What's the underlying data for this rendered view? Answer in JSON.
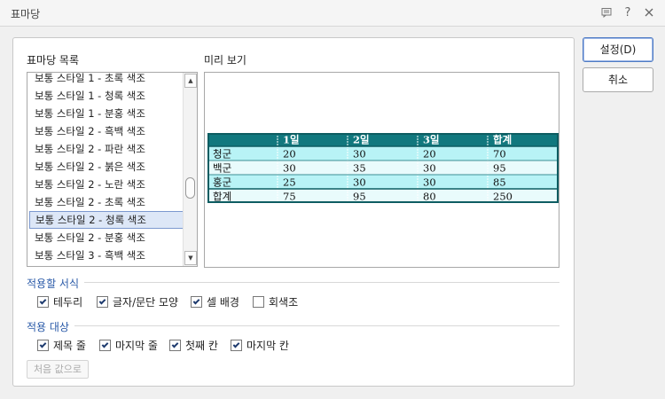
{
  "window": {
    "title": "표마당"
  },
  "titlebar_icons": [
    "comment-icon",
    "help-icon",
    "close-icon"
  ],
  "labels": {
    "list_title": "표마당 목록",
    "preview_title": "미리 보기"
  },
  "style_list": {
    "selected_index": 8,
    "items": [
      "보통 스타일 1 - 초록 색조",
      "보통 스타일 1 - 청록 색조",
      "보통 스타일 1 - 분홍 색조",
      "보통 스타일 2 - 흑백 색조",
      "보통 스타일 2 - 파란 색조",
      "보통 스타일 2 - 붉은 색조",
      "보통 스타일 2 - 노란 색조",
      "보통 스타일 2 - 초록 색조",
      "보통 스타일 2 - 청록 색조",
      "보통 스타일 2 - 분홍 색조",
      "보통 스타일 3 - 흑백 색조"
    ]
  },
  "preview_table": {
    "header": [
      "",
      "1일",
      "2일",
      "3일",
      "합계"
    ],
    "rows": [
      [
        "청군",
        "20",
        "30",
        "20",
        "70"
      ],
      [
        "백군",
        "30",
        "35",
        "30",
        "95"
      ],
      [
        "홍군",
        "25",
        "30",
        "30",
        "85"
      ],
      [
        "합계",
        "75",
        "95",
        "80",
        "250"
      ]
    ],
    "colors": {
      "header": "#11787e",
      "light": "#b8f3f6",
      "pale": "#e9fbfc",
      "border": "#3d8f94"
    }
  },
  "apply_format": {
    "title": "적용할 서식",
    "options": [
      {
        "label": "테두리",
        "checked": true
      },
      {
        "label": "글자/문단 모양",
        "checked": true
      },
      {
        "label": "셀 배경",
        "checked": true
      },
      {
        "label": "회색조",
        "checked": false
      }
    ]
  },
  "apply_target": {
    "title": "적용 대상",
    "options": [
      {
        "label": "제목 줄",
        "checked": true
      },
      {
        "label": "마지막 줄",
        "checked": true
      },
      {
        "label": "첫째 칸",
        "checked": true
      },
      {
        "label": "마지막 칸",
        "checked": true
      }
    ]
  },
  "buttons": {
    "reset": "처음 값으로",
    "set": "설정(D)",
    "cancel": "취소"
  }
}
